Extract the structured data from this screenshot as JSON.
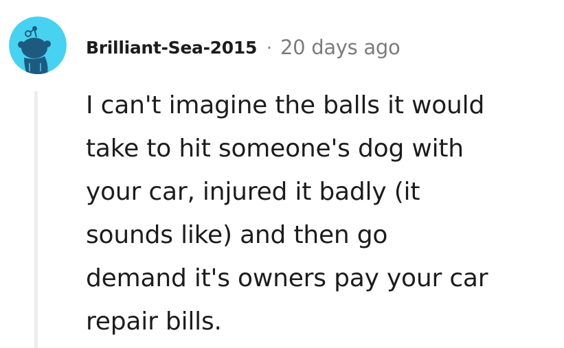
{
  "comment": {
    "avatar_icon": "reddit-snoo-avatar-icon",
    "colors": {
      "avatar_background": "#46D2F0",
      "avatar_figure": "#1E5A80",
      "thread_line": "#EDEDED",
      "username": "#1C1C1C",
      "meta": "#7C7C7C",
      "body": "#1C1C1C"
    },
    "username": "Brilliant-Sea-2015",
    "separator": "·",
    "timestamp": "20 days ago",
    "body_lines": [
      "I can't imagine the balls it would",
      "take to hit someone's dog with",
      "your car, injured it badly (it",
      "sounds like) and then go",
      "demand it's owners pay your car",
      "repair bills."
    ]
  }
}
